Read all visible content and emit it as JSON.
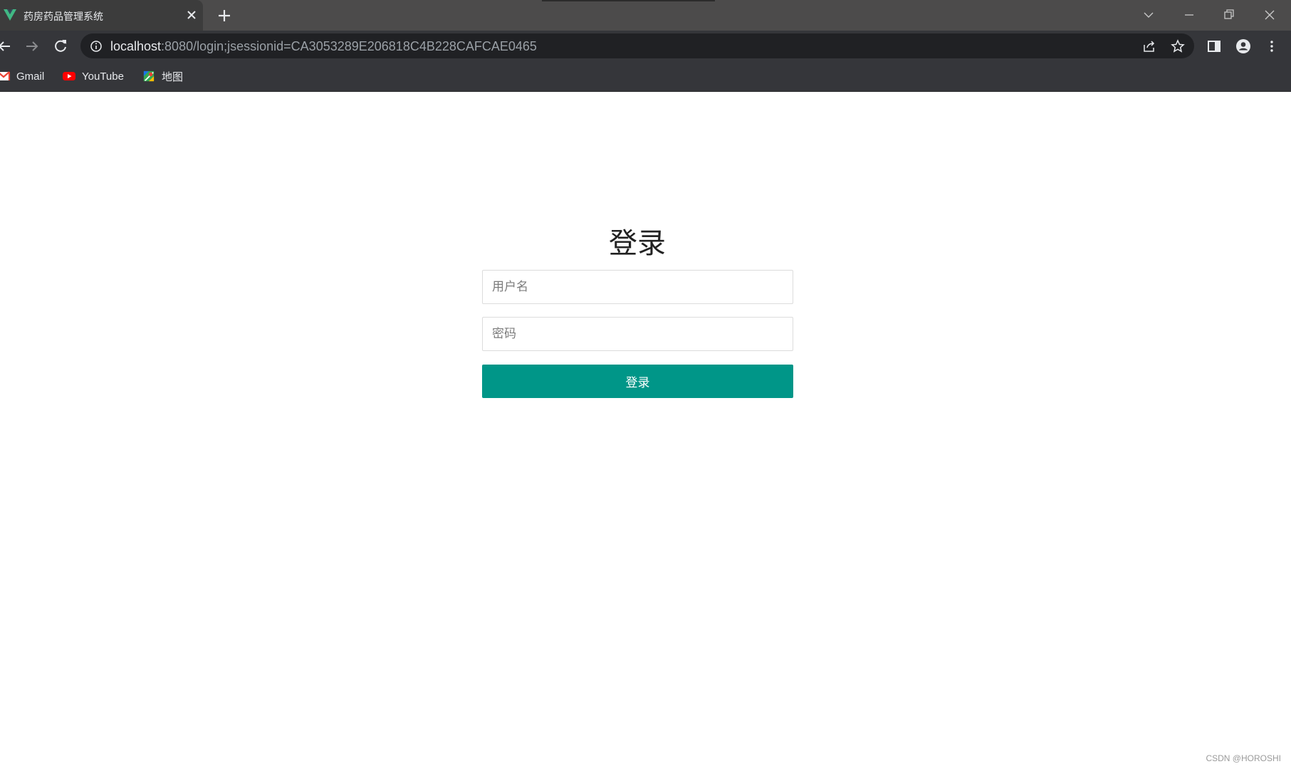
{
  "browser": {
    "tab_title": "药房药品管理系统",
    "url_host": "localhost",
    "url_rest": ":8080/login;jsessionid=CA3053289E206818C4B228CAFCAE0465",
    "bookmarks": [
      {
        "label": "Gmail",
        "icon": "gmail-icon"
      },
      {
        "label": "YouTube",
        "icon": "youtube-icon"
      },
      {
        "label": "地图",
        "icon": "maps-icon"
      }
    ]
  },
  "login": {
    "title": "登录",
    "username_placeholder": "用户名",
    "username_value": "",
    "password_placeholder": "密码",
    "password_value": "",
    "submit_label": "登录"
  },
  "watermark": "CSDN @HOROSHI",
  "colors": {
    "accent": "#009688",
    "tabstrip": "#4c4b4b",
    "toolbar": "#35363a",
    "omnibox": "#202124"
  }
}
